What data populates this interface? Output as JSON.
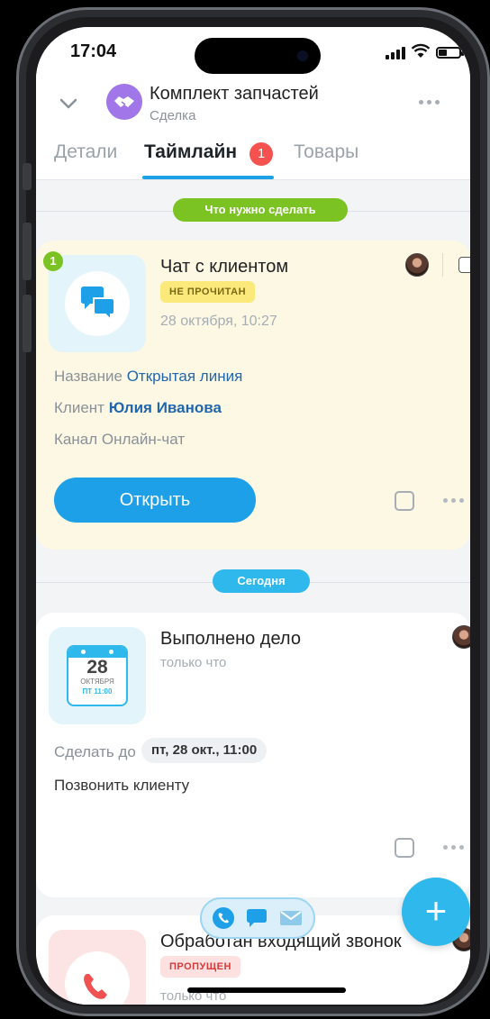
{
  "status": {
    "time": "17:04"
  },
  "header": {
    "title": "Комплект запчастей",
    "subtitle": "Сделка"
  },
  "tabs": [
    {
      "label": "Детали"
    },
    {
      "label": "Таймлайн",
      "badge": "1"
    },
    {
      "label": "Товары"
    }
  ],
  "sections": {
    "todo": "Что нужно сделать",
    "today": "Сегодня"
  },
  "chat_card": {
    "counter": "1",
    "title": "Чат с клиентом",
    "status": "НЕ ПРОЧИТАН",
    "date": "28 октября, 10:27",
    "fields": [
      {
        "label": "Название",
        "value": "Открытая линия"
      },
      {
        "label": "Клиент",
        "value": "Юлия Иванова"
      },
      {
        "label": "Канал",
        "value": "Онлайн-чат"
      }
    ],
    "open_button": "Открыть"
  },
  "task_card": {
    "title": "Выполнено дело",
    "time": "только что",
    "calendar": {
      "day": "28",
      "month": "ОКТЯБРЯ",
      "time": "ПТ 11:00"
    },
    "deadline_label": "Сделать до",
    "deadline_value": "пт, 28 окт., 11:00",
    "description": "Позвонить клиенту"
  },
  "call_card": {
    "title": "Обработан входящий звонок",
    "status": "ПРОПУЩЕН",
    "time": "только что"
  },
  "fab": {
    "label": "+"
  },
  "colors": {
    "accent": "#1ea0e8",
    "todo_pill": "#7bc322",
    "today_pill": "#2fb8ec",
    "badge": "#f5524f",
    "deal_icon": "#a076e8"
  }
}
